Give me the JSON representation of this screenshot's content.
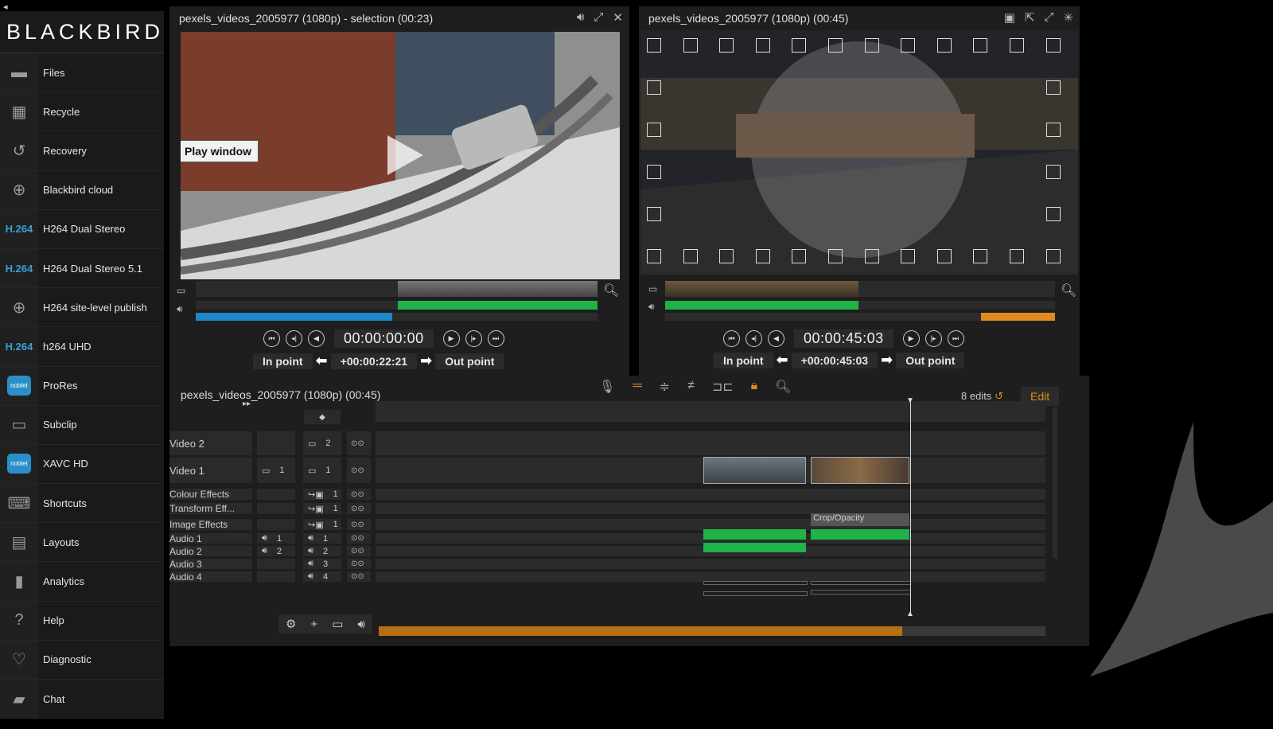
{
  "app": {
    "back": "◂",
    "logo": "BLACKBIRD"
  },
  "sidebar": {
    "items": [
      {
        "label": "Files",
        "icon": "folder-icon",
        "glyph": "▬"
      },
      {
        "label": "Recycle",
        "icon": "recycle-bin-icon",
        "glyph": "▦"
      },
      {
        "label": "Recovery",
        "icon": "history-icon",
        "glyph": "↺"
      },
      {
        "label": "Blackbird cloud",
        "icon": "globe-icon",
        "glyph": "⊕"
      },
      {
        "label": "H264 Dual Stereo",
        "icon": "h264-icon",
        "glyph": "H.264"
      },
      {
        "label": "H264 Dual Stereo 5.1",
        "icon": "h264-icon",
        "glyph": "H.264"
      },
      {
        "label": "H264 site-level publish",
        "icon": "globe-icon",
        "glyph": "⊕"
      },
      {
        "label": "h264 UHD",
        "icon": "h264-icon",
        "glyph": "H.264"
      },
      {
        "label": "ProRes",
        "icon": "noblet-icon",
        "glyph": "noblet"
      },
      {
        "label": "Subclip",
        "icon": "film-icon",
        "glyph": "▭"
      },
      {
        "label": "XAVC HD",
        "icon": "noblet-icon",
        "glyph": "noblet"
      },
      {
        "label": "Shortcuts",
        "icon": "keyboard-icon",
        "glyph": "⌨"
      },
      {
        "label": "Layouts",
        "icon": "layouts-icon",
        "glyph": "▤"
      },
      {
        "label": "Analytics",
        "icon": "bar-chart-icon",
        "glyph": "▮"
      },
      {
        "label": "Help",
        "icon": "question-icon",
        "glyph": "?"
      },
      {
        "label": "Diagnostic",
        "icon": "stethoscope-icon",
        "glyph": "♡"
      },
      {
        "label": "Chat",
        "icon": "chat-icon",
        "glyph": "▰"
      }
    ]
  },
  "left_viewer": {
    "title": "pexels_videos_2005977 (1080p) - selection (00:23)",
    "tooltip": "Play window",
    "timecode": "00:00:00:00",
    "in_label": "In point",
    "duration": "+00:00:22:21",
    "out_label": "Out point"
  },
  "right_viewer": {
    "title": "pexels_videos_2005977 (1080p) (00:45)",
    "timecode": "00:00:45:03",
    "in_label": "In point",
    "duration": "+00:00:45:03",
    "out_label": "Out point"
  },
  "timeline": {
    "title": "pexels_videos_2005977 (1080p) (00:45)",
    "edits": "8 edits",
    "mode": "Edit",
    "tracks": [
      {
        "name": "Video 2",
        "a": "",
        "b": "2"
      },
      {
        "name": "Video 1",
        "a": "1",
        "b": "1"
      },
      {
        "name": "Colour Effects",
        "a": "",
        "b": "1"
      },
      {
        "name": "Transform Eff...",
        "a": "",
        "b": "1"
      },
      {
        "name": "Image Effects",
        "a": "",
        "b": "1"
      },
      {
        "name": "Audio 1",
        "a": "1",
        "b": "1"
      },
      {
        "name": "Audio 2",
        "a": "2",
        "b": "2"
      },
      {
        "name": "Audio 3",
        "a": "",
        "b": "3"
      },
      {
        "name": "Audio 4",
        "a": "",
        "b": "4"
      }
    ],
    "effect_clip": "Crop/Opacity"
  },
  "colors": {
    "accent_orange": "#e08a1e",
    "audio_green": "#1fb34a",
    "progress_blue": "#1f86c9"
  }
}
